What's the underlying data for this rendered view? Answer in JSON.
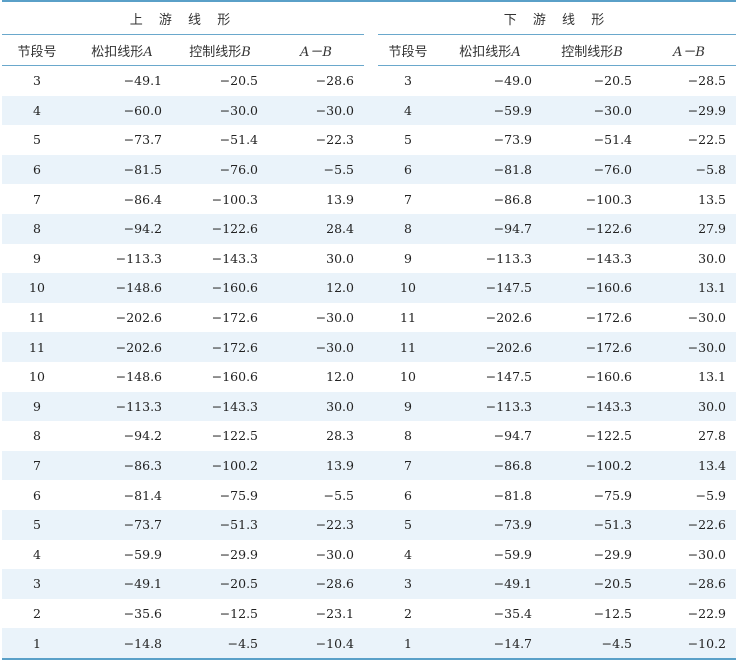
{
  "table": {
    "groups": {
      "upstream": "上 游 线 形",
      "downstream": "下 游 线 形"
    },
    "columns": {
      "segment": "节段号",
      "loose": "松扣线形",
      "loose_var": "A",
      "control": "控制线形",
      "control_var": "B",
      "diff": "A－B"
    },
    "rows": [
      {
        "u_seg": "3",
        "u_a": "−49.1",
        "u_b": "−20.5",
        "u_d": "−28.6",
        "d_seg": "3",
        "d_a": "−49.0",
        "d_b": "−20.5",
        "d_d": "−28.5"
      },
      {
        "u_seg": "4",
        "u_a": "−60.0",
        "u_b": "−30.0",
        "u_d": "−30.0",
        "d_seg": "4",
        "d_a": "−59.9",
        "d_b": "−30.0",
        "d_d": "−29.9"
      },
      {
        "u_seg": "5",
        "u_a": "−73.7",
        "u_b": "−51.4",
        "u_d": "−22.3",
        "d_seg": "5",
        "d_a": "−73.9",
        "d_b": "−51.4",
        "d_d": "−22.5"
      },
      {
        "u_seg": "6",
        "u_a": "−81.5",
        "u_b": "−76.0",
        "u_d": "−5.5",
        "d_seg": "6",
        "d_a": "−81.8",
        "d_b": "−76.0",
        "d_d": "−5.8"
      },
      {
        "u_seg": "7",
        "u_a": "−86.4",
        "u_b": "−100.3",
        "u_d": "13.9",
        "d_seg": "7",
        "d_a": "−86.8",
        "d_b": "−100.3",
        "d_d": "13.5"
      },
      {
        "u_seg": "8",
        "u_a": "−94.2",
        "u_b": "−122.6",
        "u_d": "28.4",
        "d_seg": "8",
        "d_a": "−94.7",
        "d_b": "−122.6",
        "d_d": "27.9"
      },
      {
        "u_seg": "9",
        "u_a": "−113.3",
        "u_b": "−143.3",
        "u_d": "30.0",
        "d_seg": "9",
        "d_a": "−113.3",
        "d_b": "−143.3",
        "d_d": "30.0"
      },
      {
        "u_seg": "10",
        "u_a": "−148.6",
        "u_b": "−160.6",
        "u_d": "12.0",
        "d_seg": "10",
        "d_a": "−147.5",
        "d_b": "−160.6",
        "d_d": "13.1"
      },
      {
        "u_seg": "11",
        "u_a": "−202.6",
        "u_b": "−172.6",
        "u_d": "−30.0",
        "d_seg": "11",
        "d_a": "−202.6",
        "d_b": "−172.6",
        "d_d": "−30.0"
      },
      {
        "u_seg": "11",
        "u_a": "−202.6",
        "u_b": "−172.6",
        "u_d": "−30.0",
        "d_seg": "11",
        "d_a": "−202.6",
        "d_b": "−172.6",
        "d_d": "−30.0"
      },
      {
        "u_seg": "10",
        "u_a": "−148.6",
        "u_b": "−160.6",
        "u_d": "12.0",
        "d_seg": "10",
        "d_a": "−147.5",
        "d_b": "−160.6",
        "d_d": "13.1"
      },
      {
        "u_seg": "9",
        "u_a": "−113.3",
        "u_b": "−143.3",
        "u_d": "30.0",
        "d_seg": "9",
        "d_a": "−113.3",
        "d_b": "−143.3",
        "d_d": "30.0"
      },
      {
        "u_seg": "8",
        "u_a": "−94.2",
        "u_b": "−122.5",
        "u_d": "28.3",
        "d_seg": "8",
        "d_a": "−94.7",
        "d_b": "−122.5",
        "d_d": "27.8"
      },
      {
        "u_seg": "7",
        "u_a": "−86.3",
        "u_b": "−100.2",
        "u_d": "13.9",
        "d_seg": "7",
        "d_a": "−86.8",
        "d_b": "−100.2",
        "d_d": "13.4"
      },
      {
        "u_seg": "6",
        "u_a": "−81.4",
        "u_b": "−75.9",
        "u_d": "−5.5",
        "d_seg": "6",
        "d_a": "−81.8",
        "d_b": "−75.9",
        "d_d": "−5.9"
      },
      {
        "u_seg": "5",
        "u_a": "−73.7",
        "u_b": "−51.3",
        "u_d": "−22.3",
        "d_seg": "5",
        "d_a": "−73.9",
        "d_b": "−51.3",
        "d_d": "−22.6"
      },
      {
        "u_seg": "4",
        "u_a": "−59.9",
        "u_b": "−29.9",
        "u_d": "−30.0",
        "d_seg": "4",
        "d_a": "−59.9",
        "d_b": "−29.9",
        "d_d": "−30.0"
      },
      {
        "u_seg": "3",
        "u_a": "−49.1",
        "u_b": "−20.5",
        "u_d": "−28.6",
        "d_seg": "3",
        "d_a": "−49.1",
        "d_b": "−20.5",
        "d_d": "−28.6"
      },
      {
        "u_seg": "2",
        "u_a": "−35.6",
        "u_b": "−12.5",
        "u_d": "−23.1",
        "d_seg": "2",
        "d_a": "−35.4",
        "d_b": "−12.5",
        "d_d": "−22.9"
      },
      {
        "u_seg": "1",
        "u_a": "−14.8",
        "u_b": "−4.5",
        "u_d": "−10.4",
        "d_seg": "1",
        "d_a": "−14.7",
        "d_b": "−4.5",
        "d_d": "−10.2"
      }
    ]
  },
  "colors": {
    "rule": "#5aa0c8",
    "stripe": "#eaf3fa"
  }
}
